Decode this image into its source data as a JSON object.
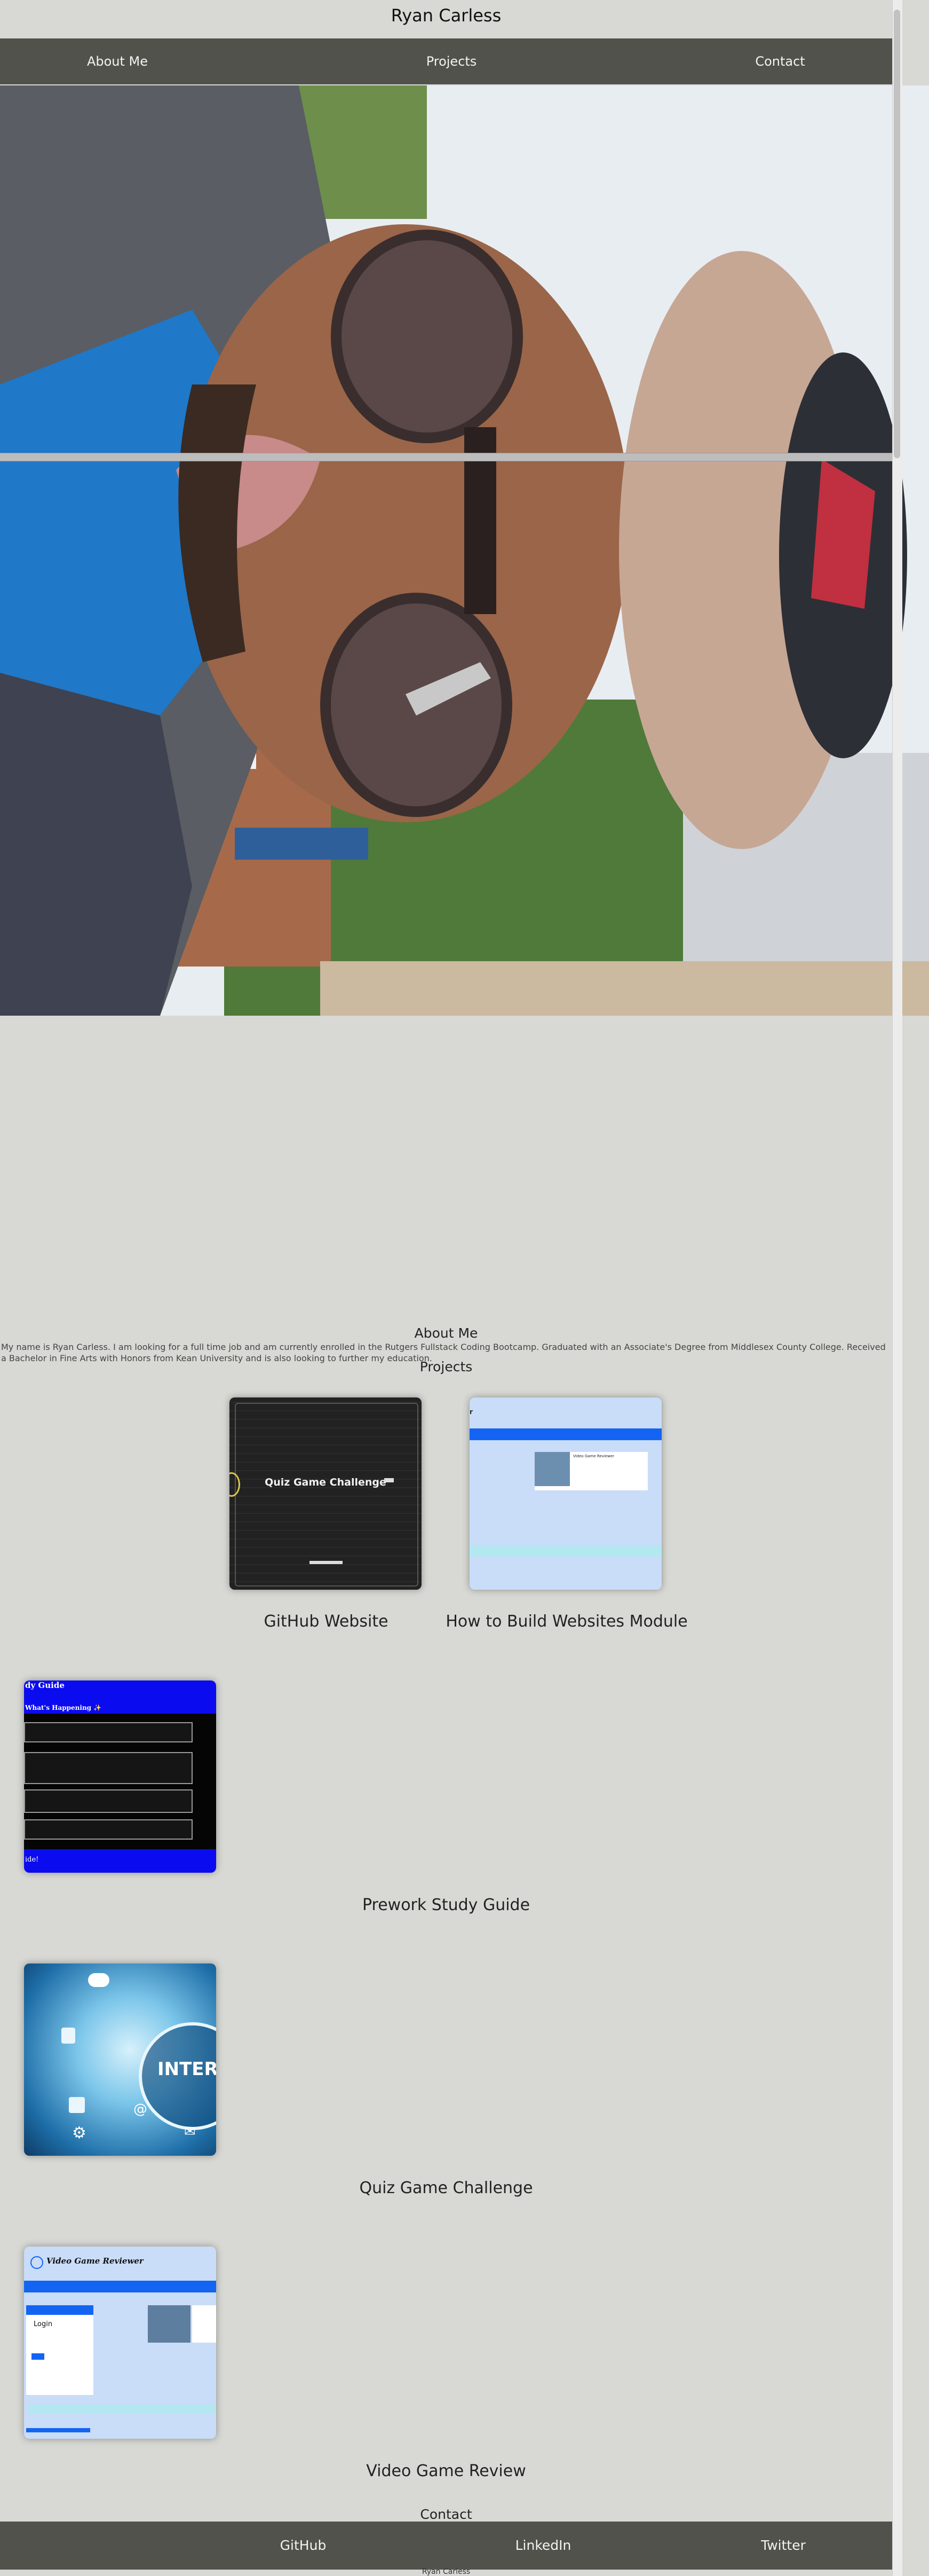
{
  "header": {
    "title": "Ryan Carless"
  },
  "nav": {
    "about": "About Me",
    "projects": "Projects",
    "contact": "Contact"
  },
  "about": {
    "heading": "About Me",
    "text": "My name is Ryan Carless. I am looking for a full time job and am currently enrolled in the Rutgers Fullstack Coding Bootcamp. Graduated with an Associate's Degree from Middlesex County College. Received a Bachelor in Fine Arts with Honors from Kean University and is also looking to further my education."
  },
  "projects": {
    "heading": "Projects",
    "items": [
      {
        "label": "GitHub Website",
        "thumb_title": "Quiz Game Challenge"
      },
      {
        "label": "How to Build Websites Module",
        "thumb_title": "Video Game Reviewer"
      },
      {
        "label": "Prework Study Guide",
        "thumb_title": "dy Guide",
        "thumb_sub": "What's Happening ✨",
        "thumb_footer": "ide!"
      },
      {
        "label": "Quiz Game Challenge",
        "thumb_title": "INTER"
      },
      {
        "label": "Video Game Review",
        "thumb_title": "Video Game Reviewer",
        "thumb_login": "Login"
      }
    ]
  },
  "contact": {
    "heading": "Contact",
    "links": {
      "github": "GitHub",
      "linkedin": "LinkedIn",
      "twitter": "Twitter"
    }
  },
  "footer": {
    "copyright": "Ryan Carless"
  },
  "colors": {
    "nav_bg": "#52524c",
    "page_bg": "#d8d9d4",
    "card_blue": "#1464f4",
    "card_light": "#c9dcf8"
  }
}
